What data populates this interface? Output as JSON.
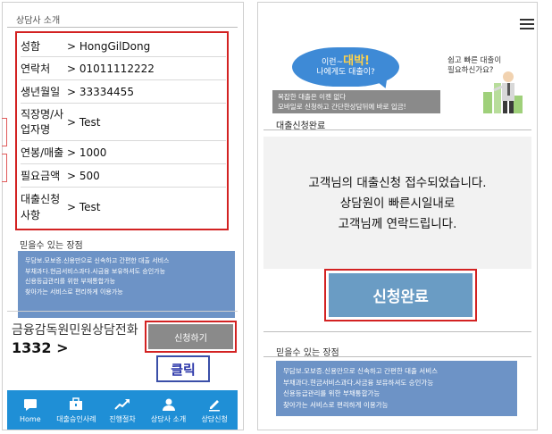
{
  "left": {
    "section_title": "상담사 소개",
    "rows": [
      {
        "label": "성함",
        "value": "> HongGilDong"
      },
      {
        "label": "연락처",
        "value": "> 01011112222"
      },
      {
        "label": "생년월일",
        "value": "> 33334455"
      },
      {
        "label1": "직장명/사",
        "label2": "업자명",
        "value": "> Test"
      },
      {
        "label": "연봉/매출",
        "value": "> 1000"
      },
      {
        "label": "필요금액",
        "value": "> 500"
      },
      {
        "label1": "대출신청",
        "label2": "사항",
        "value": "> Test"
      }
    ],
    "merit_title": "믿을수 있는 장점",
    "merits": [
      "무담보.모보증.신용만으로 신속하고 간편한 대출 서비스",
      "부채과다.현금서비스과다.사금융 보유하셔도 승인가능",
      "신용등급관리를 위한 부채통합가능",
      "찾아가는 서비스로 편리하게 이용가능"
    ],
    "fss_label": "금융감독원민원상담전화",
    "fss_number": "1332 >",
    "apply_button": "신청하기",
    "click_annotation": "클릭",
    "nav": [
      {
        "label": "Home",
        "icon": "chat-bubble-icon"
      },
      {
        "label": "대출승인사례",
        "icon": "case-icon"
      },
      {
        "label": "진행절차",
        "icon": "trend-chart-icon"
      },
      {
        "label": "상담사 소개",
        "icon": "person-icon"
      },
      {
        "label": "상담신청",
        "icon": "pencil-icon"
      }
    ]
  },
  "right": {
    "banner": {
      "bubble_line1": "이런~",
      "bubble_big": "대박!",
      "bubble_line2": "나에게도 대출이?",
      "bar_line1": "복잡한 대출은 이젠 없다",
      "bar_line2": "모바일로 신청하고 간단한상담뒤에 바로 입금!",
      "side_line1": "쉽고 빠른 대출이",
      "side_line2": "필요하신가요?"
    },
    "done_title": "대출신청완료",
    "done_msg_1": "고객님의 대출신청 접수되었습니다.",
    "done_msg_2": "상담원이 빠른시일내로",
    "done_msg_3": "고객님께 연락드립니다.",
    "complete_button": "신청완료",
    "merit_title": "믿을수 있는 장점",
    "merits": [
      "무담보.모보증.신용만으로 신속하고 간편한 대출 서비스",
      "부채과다.현금서비스과다.사금융 보유하셔도 승인가능",
      "신용등급관리를 위한 부채통합가능",
      "찾아가는 서비스로 편리하게 이용가능"
    ]
  }
}
